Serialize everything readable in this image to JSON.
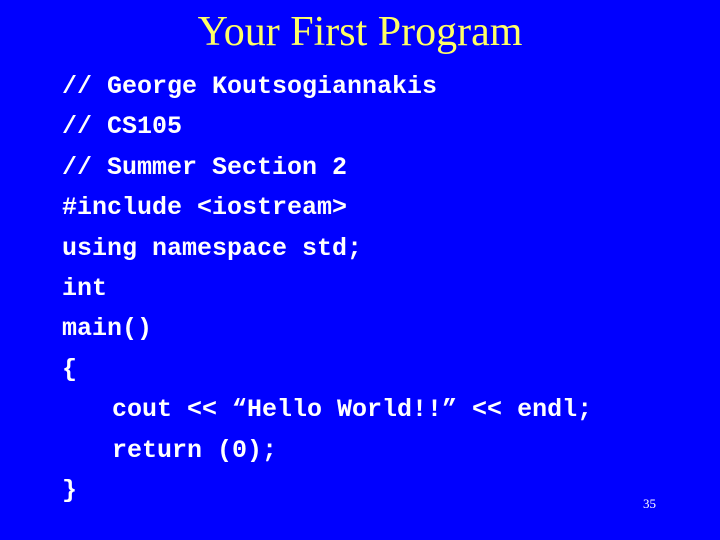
{
  "slide": {
    "title": "Your First Program",
    "code_lines": [
      "// George Koutsogiannakis",
      "// CS105",
      "// Summer Section 2",
      "#include <iostream>",
      "using namespace std;",
      "int",
      "main()",
      "{",
      "cout << “Hello World!!” << endl;",
      "return (0);",
      "}"
    ],
    "page_number": "35"
  },
  "colors": {
    "background": "#0000ff",
    "title": "#ffff66",
    "code": "#ffffff"
  }
}
